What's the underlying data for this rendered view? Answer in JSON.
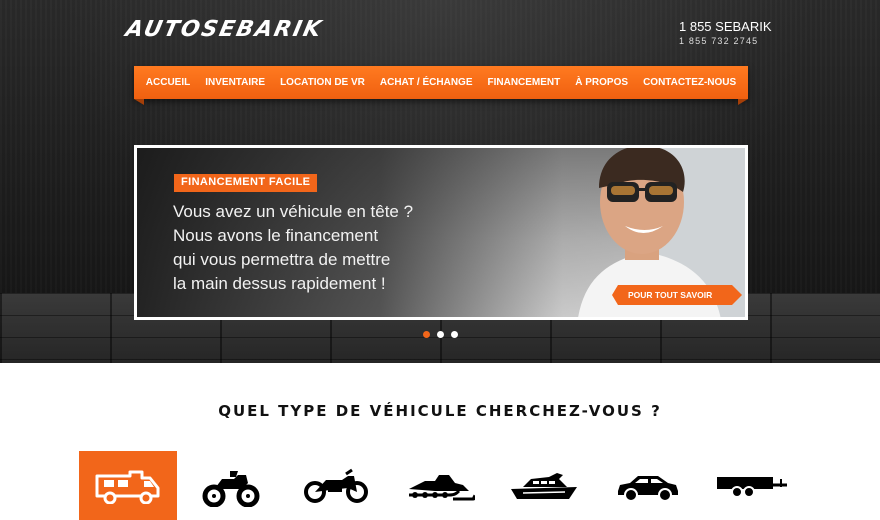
{
  "brand": {
    "logo_text": "AUTOSEBARIK"
  },
  "contact": {
    "phone_word": "1 855 SEBARIK",
    "phone_number": "1 855 732 2745"
  },
  "nav": {
    "items": [
      {
        "label": "ACCUEIL"
      },
      {
        "label": "INVENTAIRE"
      },
      {
        "label": "LOCATION DE VR"
      },
      {
        "label": "ACHAT / ÉCHANGE"
      },
      {
        "label": "FINANCEMENT"
      },
      {
        "label": "À PROPOS"
      },
      {
        "label": "CONTACTEZ-NOUS"
      }
    ]
  },
  "slider": {
    "badge": "FINANCEMENT FACILE",
    "lines": [
      "Vous avez un véhicule en tête ?",
      "Nous avons le financement",
      "qui vous permettra de mettre",
      "la main dessus rapidement !"
    ],
    "cta": "POUR TOUT SAVOIR",
    "active_slide": 1,
    "slide_count": 3
  },
  "vehicle_section": {
    "title": "QUEL TYPE DE VÉHICULE CHERCHEZ-VOUS ?",
    "types": [
      {
        "icon": "rv-icon",
        "active": true
      },
      {
        "icon": "atv-icon",
        "active": false
      },
      {
        "icon": "motorcycle-icon",
        "active": false
      },
      {
        "icon": "snowmobile-icon",
        "active": false
      },
      {
        "icon": "boat-icon",
        "active": false
      },
      {
        "icon": "car-icon",
        "active": false
      },
      {
        "icon": "trailer-icon",
        "active": false
      }
    ]
  },
  "colors": {
    "accent": "#f2661a",
    "dark": "#1b1b1b",
    "white": "#ffffff"
  }
}
